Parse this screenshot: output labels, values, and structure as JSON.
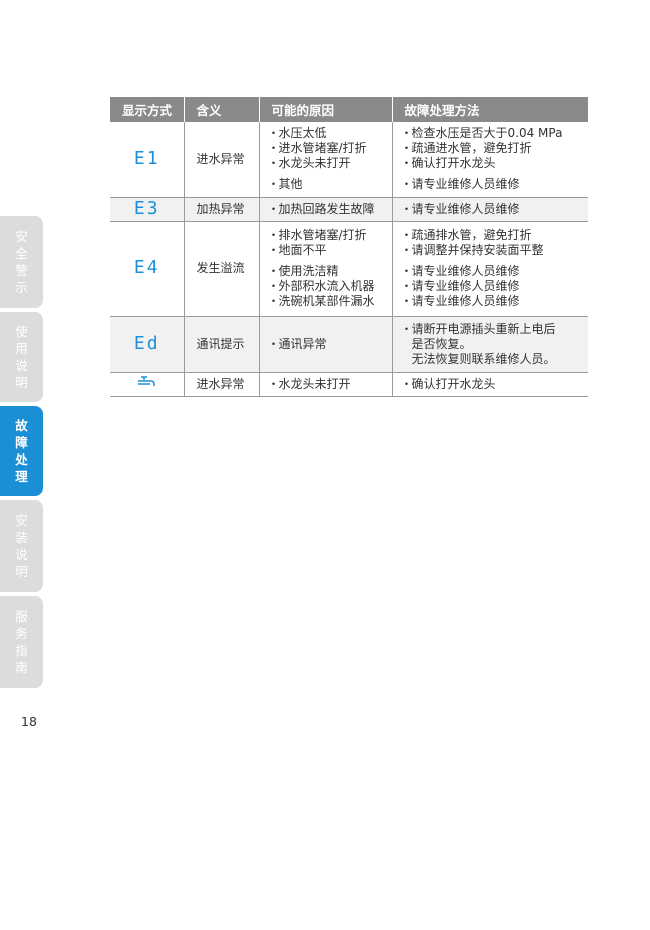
{
  "table": {
    "headers": [
      "显示方式",
      "含义",
      "可能的原因",
      "故障处理方法"
    ],
    "rows": [
      {
        "code": "E1",
        "code_icon": "seven-segment-e1",
        "meaning": "进水异常",
        "causes": [
          [
            "水压太低",
            "进水管堵塞/打折",
            "水龙头未打开"
          ],
          [
            "其他"
          ]
        ],
        "solutions": [
          [
            "检查水压是否大于0.04 MPa",
            "疏通进水管，避免打折",
            "确认打开水龙头"
          ],
          [
            "请专业维修人员维修"
          ]
        ]
      },
      {
        "code": "E3",
        "code_icon": "seven-segment-e3",
        "meaning": "加热异常",
        "causes": [
          [
            "加热回路发生故障"
          ]
        ],
        "solutions": [
          [
            "请专业维修人员维修"
          ]
        ]
      },
      {
        "code": "E4",
        "code_icon": "seven-segment-e4",
        "meaning": "发生溢流",
        "causes": [
          [
            "排水管堵塞/打折",
            "地面不平"
          ],
          [
            "使用洗洁精",
            "外部积水流入机器",
            "洗碗机某部件漏水"
          ]
        ],
        "solutions": [
          [
            "疏通排水管，避免打折",
            "请调整并保持安装面平整"
          ],
          [
            "请专业维修人员维修",
            "请专业维修人员维修",
            "请专业维修人员维修"
          ]
        ]
      },
      {
        "code": "Ed",
        "code_icon": "seven-segment-ed",
        "meaning": "通讯提示",
        "causes": [
          [
            "通讯异常"
          ]
        ],
        "solutions_lines": [
          "请断开电源插头重新上电后",
          "是否恢复。",
          "无法恢复则联系维修人员。"
        ]
      },
      {
        "code_icon": "faucet-icon",
        "meaning": "进水异常",
        "causes": [
          [
            "水龙头未打开"
          ]
        ],
        "solutions": [
          [
            "确认打开水龙头"
          ]
        ]
      }
    ]
  },
  "sidebar": {
    "tabs": [
      {
        "label": "安全警示",
        "active": false
      },
      {
        "label": "使用说明",
        "active": false
      },
      {
        "label": "故障处理",
        "active": true
      },
      {
        "label": "安装说明",
        "active": false
      },
      {
        "label": "服务指南",
        "active": false
      }
    ]
  },
  "page_number": "18",
  "colors": {
    "accent": "#1b8fd6",
    "header_bg": "#8a8a8a",
    "tab_inactive": "#dcdcdc",
    "row_alt": "#f1f1f1"
  }
}
